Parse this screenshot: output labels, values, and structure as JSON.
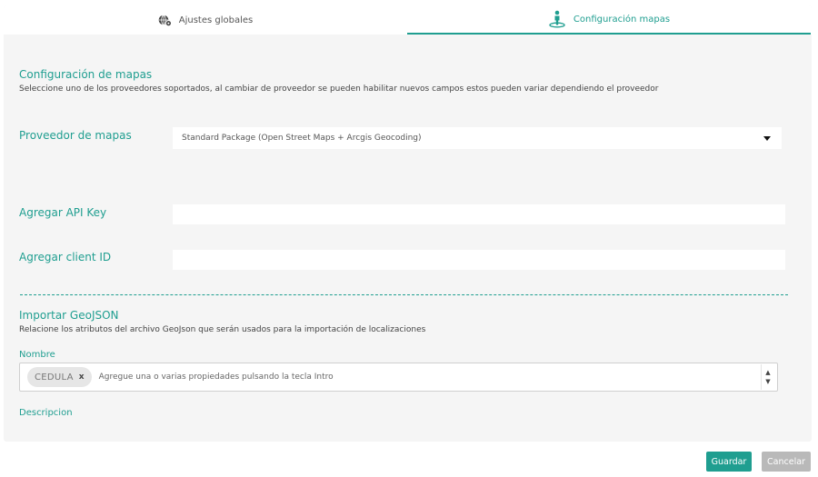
{
  "tabs": [
    {
      "label": "Ajustes globales",
      "icon": "globe-gear-icon",
      "active": false
    },
    {
      "label": "Configuración mapas",
      "icon": "map-pin-person-icon",
      "active": true
    }
  ],
  "map_config": {
    "title": "Configuración de mapas",
    "description": "Seleccione uno de los proveedores soportados, al cambiar de proveedor se pueden habilitar nuevos campos estos pueden variar dependiendo el proveedor",
    "provider_label": "Proveedor de mapas",
    "provider_value": "Standard Package (Open Street Maps + Arcgis Geocoding)",
    "api_key_label": "Agregar API Key",
    "api_key_value": "",
    "client_id_label": "Agregar client ID",
    "client_id_value": ""
  },
  "geojson": {
    "title": "Importar GeoJSON",
    "description": "Relacione los atributos del archivo GeoJson que serán usados para la importación de localizaciones",
    "name_label": "Nombre",
    "name_tags": [
      "CEDULA"
    ],
    "tag_remove": "x",
    "name_placeholder": "Agregue una o varias propiedades pulsando la tecla Intro",
    "description_label": "Descripcion"
  },
  "buttons": {
    "save": "Guardar",
    "cancel": "Cancelar"
  },
  "colors": {
    "accent": "#1f9e90",
    "panel_bg": "#f5f5f5",
    "cancel_bg": "#b9b9b9"
  }
}
